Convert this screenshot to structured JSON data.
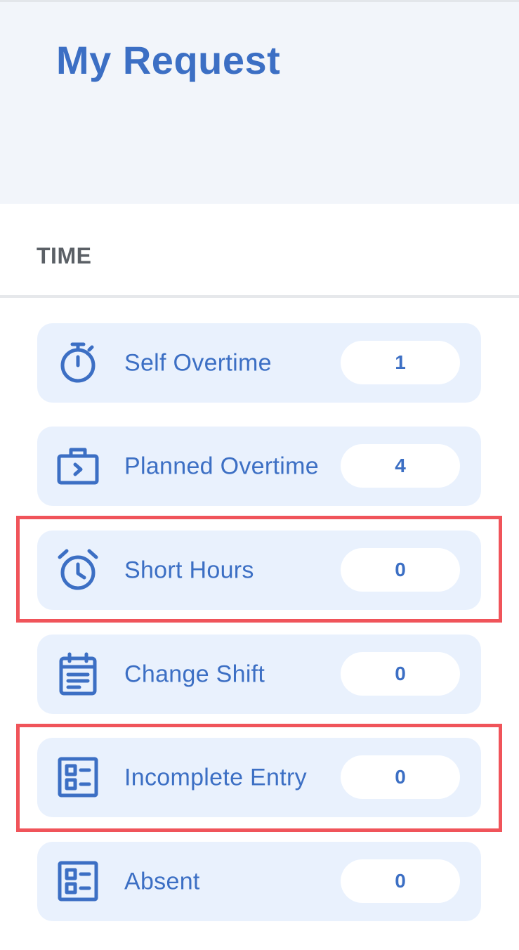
{
  "header": {
    "title": "My Request"
  },
  "section": {
    "label": "TIME"
  },
  "items": [
    {
      "label": "Self Overtime",
      "count": "1",
      "icon": "stopwatch-icon"
    },
    {
      "label": "Planned Overtime",
      "count": "4",
      "icon": "briefcase-icon"
    },
    {
      "label": "Short Hours",
      "count": "0",
      "icon": "alarm-clock-icon"
    },
    {
      "label": "Change Shift",
      "count": "0",
      "icon": "calendar-icon"
    },
    {
      "label": "Incomplete Entry",
      "count": "0",
      "icon": "form-icon"
    },
    {
      "label": "Absent",
      "count": "0",
      "icon": "form-icon"
    }
  ],
  "colors": {
    "accent": "#3c6fc4",
    "item_background": "#e9f1fd",
    "highlight": "#f0545a",
    "header_background": "#f2f5fa"
  }
}
